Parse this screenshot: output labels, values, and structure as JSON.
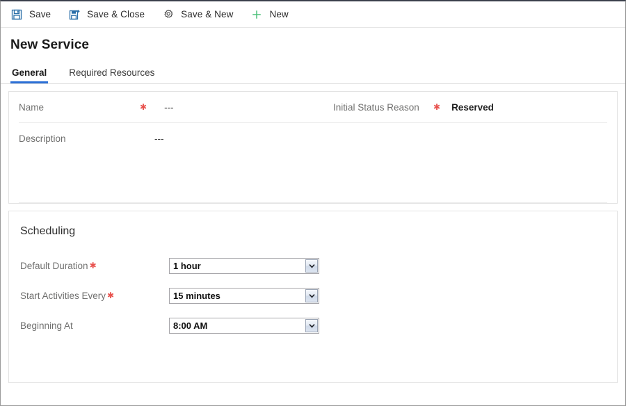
{
  "commandbar": {
    "items": [
      {
        "label": "Save",
        "icon": "save-icon"
      },
      {
        "label": "Save & Close",
        "icon": "save-and-close-icon"
      },
      {
        "label": "Save & New",
        "icon": "save-and-new-icon"
      },
      {
        "label": "New",
        "icon": "plus-icon"
      }
    ]
  },
  "header": {
    "title": "New Service",
    "tabs": [
      {
        "label": "General",
        "active": true
      },
      {
        "label": "Required Resources",
        "active": false
      }
    ]
  },
  "general": {
    "fields": {
      "name": {
        "label": "Name",
        "required": true,
        "value": "---"
      },
      "initial_status_reason": {
        "label": "Initial Status Reason",
        "required": true,
        "value": "Reserved"
      },
      "description": {
        "label": "Description",
        "required": false,
        "value": "---"
      }
    }
  },
  "scheduling": {
    "title": "Scheduling",
    "fields": [
      {
        "label": "Default Duration",
        "required": true,
        "value": "1 hour",
        "icon": "chevron-down-icon"
      },
      {
        "label": "Start Activities Every",
        "required": true,
        "value": "15 minutes",
        "icon": "chevron-down-icon"
      },
      {
        "label": "Beginning At",
        "required": false,
        "value": "8:00 AM",
        "icon": "chevron-down-icon"
      }
    ]
  },
  "colors": {
    "accent_blue": "#2b6fd6",
    "required_red": "#e8534f",
    "save_icon_blue": "#2b6fa8",
    "new_icon_green": "#4cc17a",
    "label_gray": "#70706f"
  }
}
